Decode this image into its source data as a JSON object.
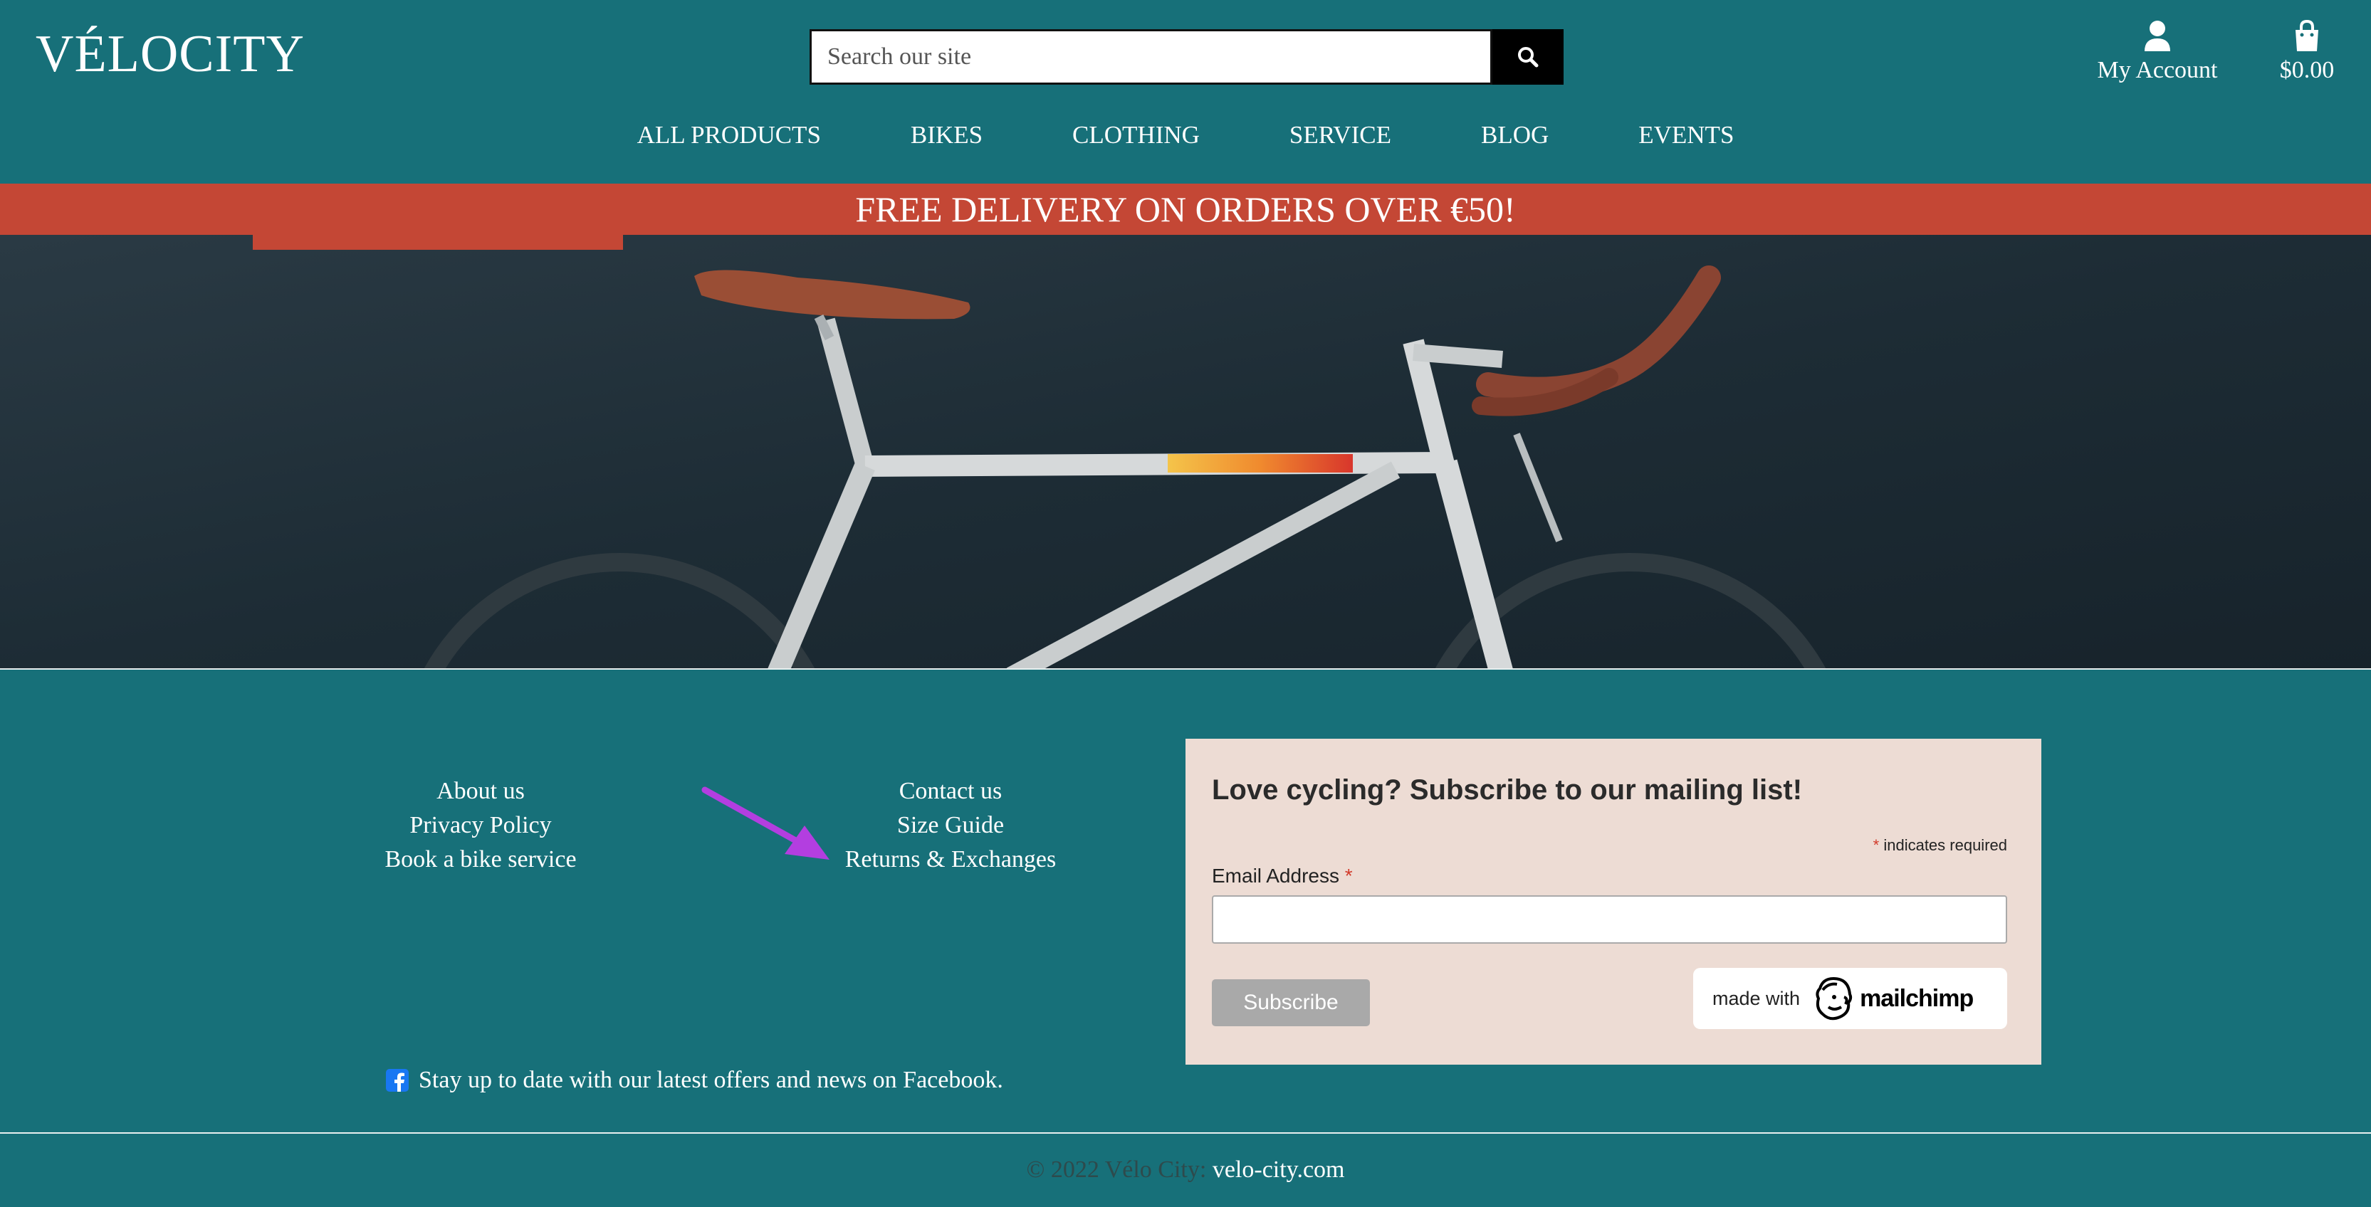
{
  "header": {
    "logo": "VÉLOCITY",
    "search_placeholder": "Search our site",
    "account_label": "My Account",
    "cart_label": "$0.00"
  },
  "nav": {
    "items": [
      {
        "label": "ALL PRODUCTS"
      },
      {
        "label": "BIKES"
      },
      {
        "label": "CLOTHING"
      },
      {
        "label": "SERVICE"
      },
      {
        "label": "BLOG"
      },
      {
        "label": "EVENTS"
      }
    ]
  },
  "banner": {
    "text": "FREE DELIVERY ON ORDERS OVER €50!"
  },
  "footer": {
    "links_left": [
      "About us",
      "Privacy Policy",
      "Book a bike service"
    ],
    "links_right": [
      "Contact us",
      "Size Guide",
      "Returns & Exchanges"
    ],
    "facebook_text": "Stay up to date with our latest offers and news on Facebook.",
    "copyright_prefix": "© 2022 Vélo City: ",
    "copyright_site": "velo-city.com"
  },
  "mailing": {
    "title": "Love cycling? Subscribe to our mailing list!",
    "required_star": "*",
    "required_text": " indicates required",
    "email_label": "Email Address ",
    "email_star": "*",
    "subscribe_label": "Subscribe",
    "badge_made_with": "made with",
    "badge_brand": "mailchimp"
  },
  "colors": {
    "teal": "#177079",
    "banner_red": "#c44735",
    "mailing_bg": "#eddcd4",
    "arrow": "#b33ee0",
    "facebook": "#1877f2"
  },
  "icons": {
    "search": "search-icon",
    "account": "user-icon",
    "cart": "shopping-bag-icon",
    "facebook": "facebook-icon",
    "mailchimp": "mailchimp-freddie-icon"
  }
}
